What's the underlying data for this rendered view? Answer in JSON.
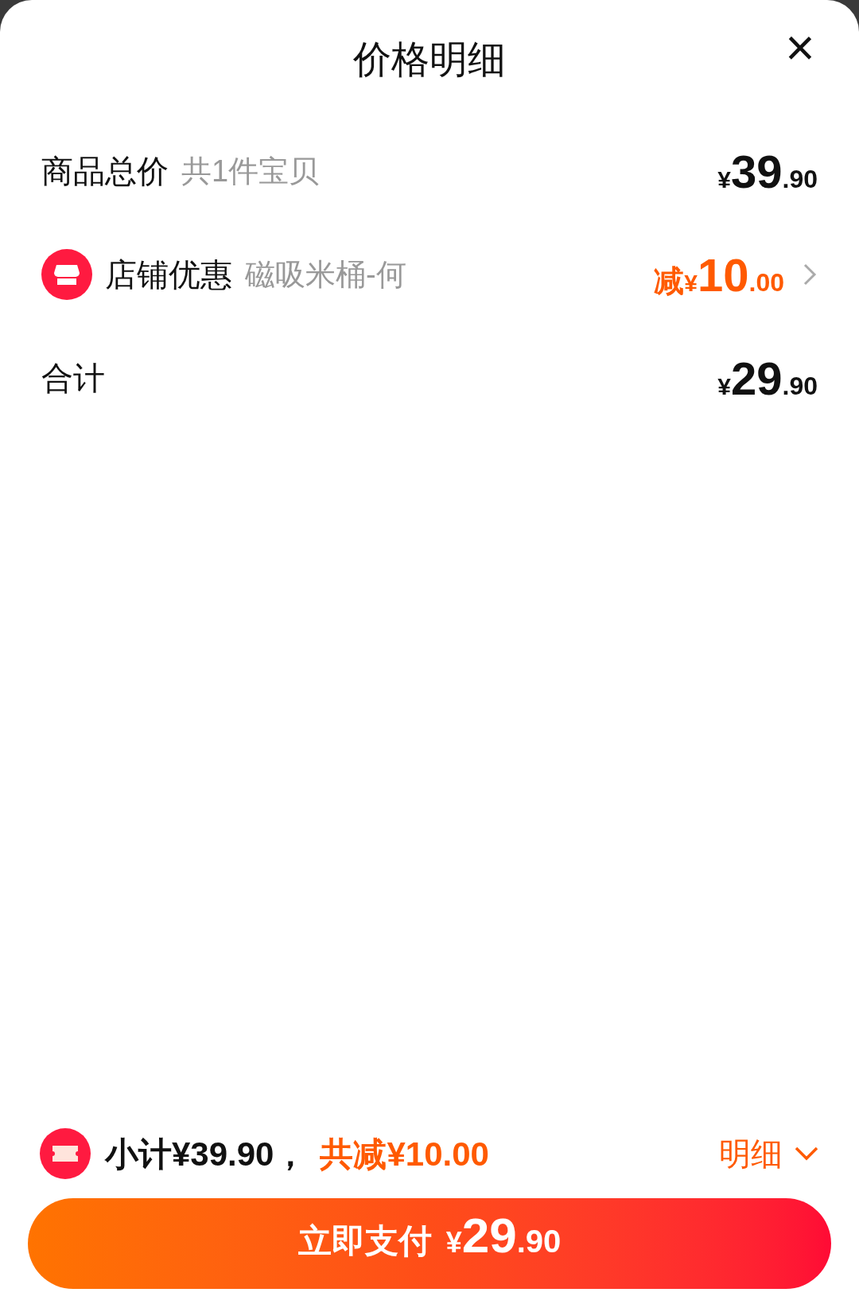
{
  "sheet": {
    "title": "价格明细",
    "close": "×"
  },
  "rows": [
    {
      "kind": "plain",
      "label": "商品总价",
      "note": "共1件宝贝",
      "prefix": "",
      "currency": "¥",
      "integer": "39",
      "decimal": ".90",
      "highlight": false,
      "has_chevron": false
    },
    {
      "kind": "store",
      "label": "店铺优惠",
      "note": "磁吸米桶-何",
      "prefix": "减",
      "currency": "¥",
      "integer": "10",
      "decimal": ".00",
      "highlight": true,
      "has_chevron": true
    },
    {
      "kind": "plain",
      "label": "合计",
      "currency": "¥",
      "integer": "29",
      "decimal": ".90",
      "highlight": false,
      "has_chevron": false
    }
  ],
  "summary": {
    "subtotal": "小计¥39.90，",
    "discount": "共减¥10.00",
    "details": "明细",
    "expanded": true
  },
  "pay_button": {
    "label": "立即支付",
    "currency": "¥",
    "integer": "29",
    "decimal": ".90"
  }
}
